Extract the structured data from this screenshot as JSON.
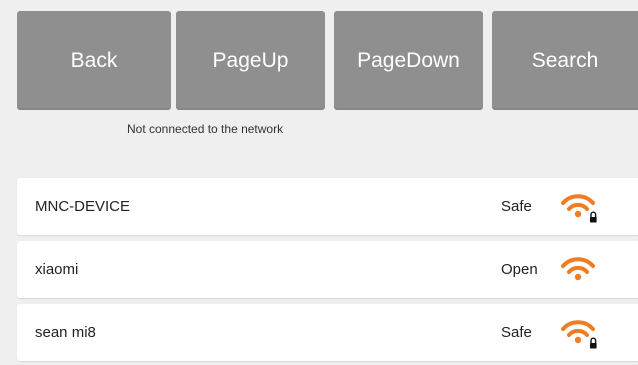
{
  "toolbar": {
    "back_label": "Back",
    "pageup_label": "PageUp",
    "pagedown_label": "PageDown",
    "search_label": "Search"
  },
  "status": {
    "text": "Not connected to the network"
  },
  "networks": [
    {
      "name": "MNC-DEVICE",
      "security": "Safe",
      "icon": "wifi-locked-icon"
    },
    {
      "name": "xiaomi",
      "security": "Open",
      "icon": "wifi-icon"
    },
    {
      "name": "sean mi8",
      "security": "Safe",
      "icon": "wifi-locked-icon"
    }
  ],
  "colors": {
    "button_bg": "#8f8f8f",
    "wifi_orange": "#f07d22",
    "page_bg": "#efefef"
  }
}
